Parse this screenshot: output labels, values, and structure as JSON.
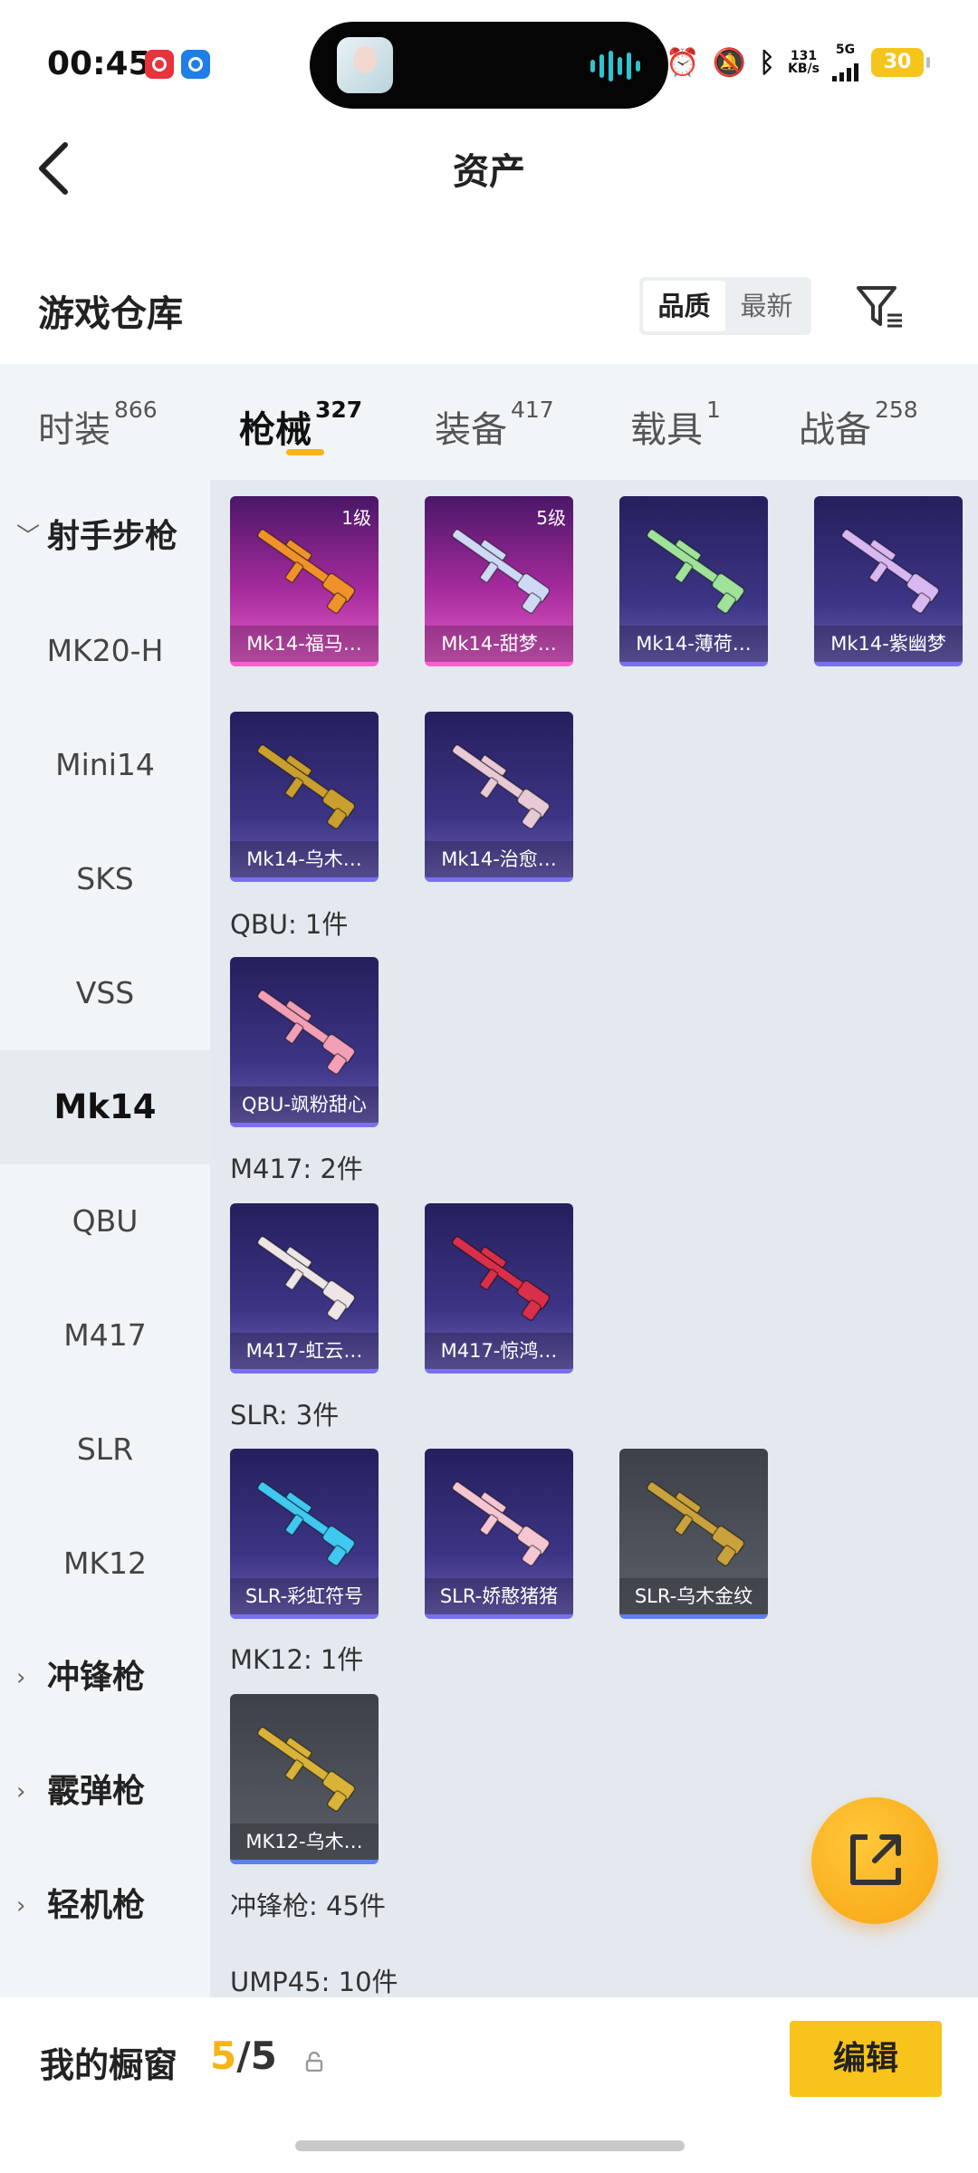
{
  "status_bar": {
    "time": "00:45",
    "net_speed_value": "131",
    "net_speed_unit": "KB/s",
    "network": "5G",
    "battery": "30"
  },
  "header": {
    "title": "资产"
  },
  "warehouse": {
    "title": "游戏仓库",
    "sort_options": [
      "品质",
      "最新"
    ],
    "active_sort": "品质"
  },
  "tabs": [
    {
      "label": "时装",
      "count": "866"
    },
    {
      "label": "枪械",
      "count": "327"
    },
    {
      "label": "装备",
      "count": "417"
    },
    {
      "label": "载具",
      "count": "1"
    },
    {
      "label": "战备",
      "count": "258"
    }
  ],
  "active_tab": "枪械",
  "sidebar": [
    {
      "label": "射手步枪",
      "type": "group",
      "expanded": true
    },
    {
      "label": "MK20-H"
    },
    {
      "label": "Mini14"
    },
    {
      "label": "SKS"
    },
    {
      "label": "VSS"
    },
    {
      "label": "Mk14",
      "active": true
    },
    {
      "label": "QBU"
    },
    {
      "label": "M417"
    },
    {
      "label": "SLR"
    },
    {
      "label": "MK12"
    },
    {
      "label": "冲锋枪",
      "type": "group",
      "expanded": false
    },
    {
      "label": "霰弹枪",
      "type": "group",
      "expanded": false
    },
    {
      "label": "轻机枪",
      "type": "group",
      "expanded": false
    }
  ],
  "items": [
    {
      "label": "Mk14-福马…",
      "level": "1级",
      "rarity": "pink",
      "gun_color": "#f0922a"
    },
    {
      "label": "Mk14-甜梦…",
      "level": "5级",
      "rarity": "pink",
      "gun_color": "#cfd8f5"
    },
    {
      "label": "Mk14-薄荷…",
      "rarity": "purple",
      "gun_color": "#9fe39a"
    },
    {
      "label": "Mk14-紫幽梦",
      "rarity": "purple",
      "gun_color": "#d9b8f2"
    },
    {
      "label": "Mk14-乌木…",
      "rarity": "purple",
      "gun_color": "#c9a030"
    },
    {
      "label": "Mk14-治愈…",
      "rarity": "purple",
      "gun_color": "#e8c9d6"
    },
    {
      "label": "QBU-飒粉甜心",
      "rarity": "purple",
      "gun_color": "#f2a0b5"
    },
    {
      "label": "M417-虹云…",
      "rarity": "purple",
      "gun_color": "#eee6e6"
    },
    {
      "label": "M417-惊鸿…",
      "rarity": "purple",
      "gun_color": "#d8304a"
    },
    {
      "label": "SLR-彩虹符号",
      "rarity": "purple",
      "gun_color": "#40c8f0"
    },
    {
      "label": "SLR-娇憨猪猪",
      "rarity": "purple",
      "gun_color": "#f5c6d2"
    },
    {
      "label": "SLR-乌木金纹",
      "rarity": "gray",
      "gun_color": "#c8a23c"
    },
    {
      "label": "MK12-乌木…",
      "rarity": "gray",
      "gun_color": "#d9b238"
    }
  ],
  "group_labels": [
    "QBU: 1件",
    "M417: 2件",
    "SLR: 3件",
    "MK12: 1件",
    "冲锋枪: 45件",
    "UMP45: 10件"
  ],
  "bottom_bar": {
    "showcase_label": "我的橱窗",
    "count_current": "5",
    "count_sep": "/",
    "count_max": "5",
    "edit_label": "编辑"
  },
  "colors": {
    "accent": "#f5b419",
    "edit_button": "#f8c31a",
    "sidebar_bg": "#f2f5f8",
    "grid_bg": "#e4e9ef"
  }
}
